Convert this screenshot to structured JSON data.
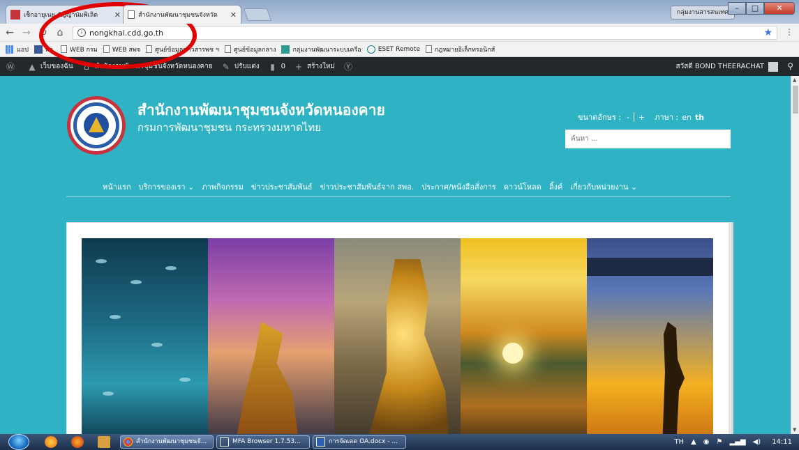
{
  "browser": {
    "tabs": [
      {
        "title": "เช็กอายุเนย สัญญานัมพิเลิต",
        "active": false
      },
      {
        "title": "สำนักงานพัฒนาชุมชนจังหวัด",
        "active": true
      }
    ],
    "profile_label": "กลุ่มงานสารสนเทศ",
    "url": "nongkhai.cdd.go.th",
    "bookmarks": [
      "แอป",
      "พจ.",
      "WEB กรม",
      "WEB สพจ",
      "ศูนย์ข้อมูลข่าวสารพช ฯ",
      "ศูนย์ข้อมูลกลาง",
      "กลุ่มงานพัฒนาระบบเครือ",
      "ESET Remote",
      "กฎหมายอิเล็กทรอนิกส์"
    ]
  },
  "wp_admin": {
    "my_sites": "เว็บของฉัน",
    "site_title": "สำนักงานพัฒนาชุมชนจังหวัดหนองคาย",
    "customize": "ปรับแต่ง",
    "comments_count": "0",
    "new": "สร้างใหม่",
    "greeting": "สวัสดี BOND THEERACHAT"
  },
  "site": {
    "name": "สำนักงานพัฒนาชุมชนจังหวัดหนองคาย",
    "subtitle": "กรมการพัฒนาชุมชน กระทรวงมหาดไทย",
    "font_size_label": "ขนาดอักษร :",
    "font_decrease": "-",
    "font_increase": "+",
    "language_label": "ภาษา :",
    "lang_en": "en",
    "lang_th": "th",
    "search_placeholder": "ค้นหา ...",
    "nav": [
      "หน้าแรก",
      "บริการของเรา ⌄",
      "ภาพกิจกรรม",
      "ข่าวประชาสัมพันธ์",
      "ข่าวประชาสัมพันธ์จาก สพอ.",
      "ประกาศ/หนังสือสั่งการ",
      "ดาวน์โหลด",
      "ลิ้งค์",
      "เกี่ยวกับหน่วยงาน ⌄"
    ]
  },
  "taskbar": {
    "items": [
      "สำนักงานพัฒนาชุมชนจั...",
      "MFA Browser 1.7.53...",
      "การจัดเดด OA.docx - ..."
    ],
    "lang": "TH",
    "clock": "14:11"
  },
  "colors": {
    "site_bg": "#2fb3c4",
    "wp_bar": "#23282d",
    "annotation": "#e00000"
  }
}
